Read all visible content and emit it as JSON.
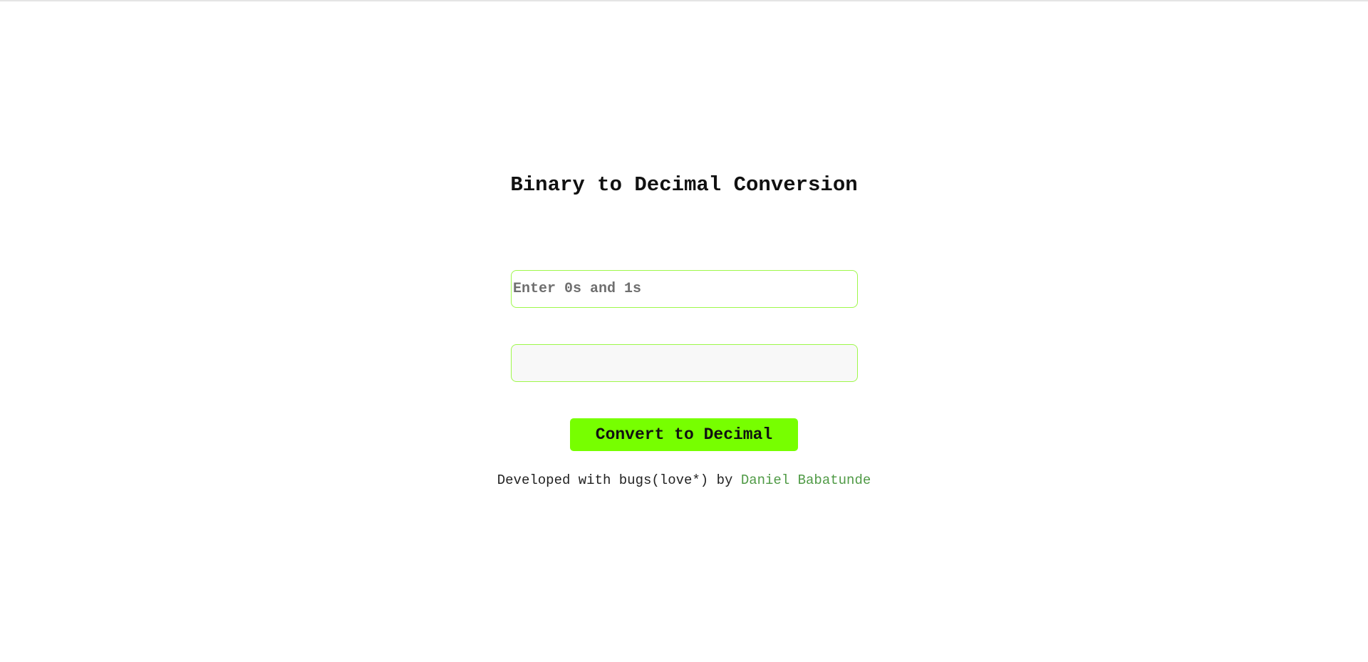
{
  "page": {
    "title": "Binary to Decimal Conversion"
  },
  "form": {
    "binary_placeholder": "Enter 0s and 1s",
    "binary_value": "",
    "decimal_value": "",
    "convert_label": "Convert to Decimal"
  },
  "footer": {
    "text": "Developed with bugs(love*) by",
    "author_name": "Daniel Babatunde"
  },
  "colors": {
    "accent": "#77ff00",
    "field_border": "#9ef84a",
    "link": "#4f9a45"
  }
}
